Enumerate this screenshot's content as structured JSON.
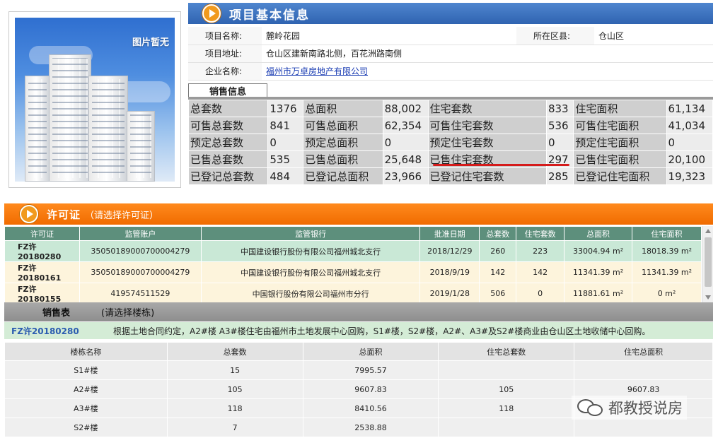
{
  "photo": {
    "label": "图片暂无"
  },
  "info": {
    "title": "项目基本信息",
    "project_name_label": "项目名称:",
    "project_name": "麓岭花园",
    "district_label": "所在区县:",
    "district": "仓山区",
    "address_label": "项目地址:",
    "address": "仓山区建新南路北侧，百花洲路南侧",
    "company_label": "企业名称:",
    "company": "福州市万卓房地产有限公司"
  },
  "sales": {
    "tab_label": "销售信息",
    "rows": [
      [
        [
          "总套数",
          "1376"
        ],
        [
          "总面积",
          "88,002"
        ],
        [
          "住宅套数",
          "833"
        ],
        [
          "住宅面积",
          "61,134"
        ]
      ],
      [
        [
          "可售总套数",
          "841"
        ],
        [
          "可售总面积",
          "62,354"
        ],
        [
          "可售住宅套数",
          "536"
        ],
        [
          "可售住宅面积",
          "41,034"
        ]
      ],
      [
        [
          "预定总套数",
          "0"
        ],
        [
          "预定总面积",
          "0"
        ],
        [
          "预定住宅套数",
          "0"
        ],
        [
          "预定住宅面积",
          "0"
        ]
      ],
      [
        [
          "已售总套数",
          "535"
        ],
        [
          "已售总面积",
          "25,648"
        ],
        [
          "已售住宅套数",
          "297"
        ],
        [
          "已售住宅面积",
          "20,100"
        ]
      ],
      [
        [
          "已登记总套数",
          "484"
        ],
        [
          "已登记总面积",
          "23,966"
        ],
        [
          "已登记住宅套数",
          "285"
        ],
        [
          "已登记住宅面积",
          "19,323"
        ]
      ]
    ]
  },
  "permit": {
    "title": "许可证",
    "hint": "（请选择许可证）",
    "headers": [
      "许可证",
      "监管账户",
      "监管银行",
      "批准日期",
      "总套数",
      "住宅套数",
      "总面积",
      "住宅面积"
    ],
    "rows": [
      {
        "id": "FZ许20180280",
        "account": "35050189000700004279",
        "bank": "中国建设银行股份有限公司福州城北支行",
        "date": "2018/12/29",
        "total": "260",
        "res": "223",
        "area": "33004.94 m²",
        "res_area": "18018.39 m²"
      },
      {
        "id": "FZ许20180161",
        "account": "35050189000700004279",
        "bank": "中国建设银行股份有限公司福州城北支行",
        "date": "2018/9/19",
        "total": "142",
        "res": "142",
        "area": "11341.39 m²",
        "res_area": "11341.39 m²"
      },
      {
        "id": "FZ许20180155",
        "account": "419574511529",
        "bank": "中国银行股份有限公司福州市分行",
        "date": "2019/1/28",
        "total": "506",
        "res": "0",
        "area": "11881.61 m²",
        "res_area": "0 m²"
      }
    ]
  },
  "sales_list": {
    "title": "销售表",
    "hint": "(请选择楼栋)",
    "note_id": "FZ许20180280",
    "note": "根据土地合同约定，A2#楼 A3#楼住宅由福州市土地发展中心回购，S1#楼，S2#楼，A2#、A3#及S2#楼商业由仓山区土地收储中心回购。",
    "headers": [
      "楼栋名称",
      "总套数",
      "总面积",
      "住宅总套数",
      "住宅总面积"
    ],
    "rows": [
      [
        "S1#楼",
        "15",
        "7995.57",
        "",
        ""
      ],
      [
        "A2#楼",
        "105",
        "9607.83",
        "105",
        "9607.83"
      ],
      [
        "A3#楼",
        "118",
        "8410.56",
        "118",
        ""
      ],
      [
        "S2#楼",
        "7",
        "2538.88",
        "",
        ""
      ]
    ]
  },
  "watermark": {
    "text": "都教授说房"
  },
  "colors": {
    "info_bar": "#2f63b1",
    "permit_bar": "#f06b00",
    "selected_row": "#c9e8d6",
    "underline": "#d51b1b"
  }
}
